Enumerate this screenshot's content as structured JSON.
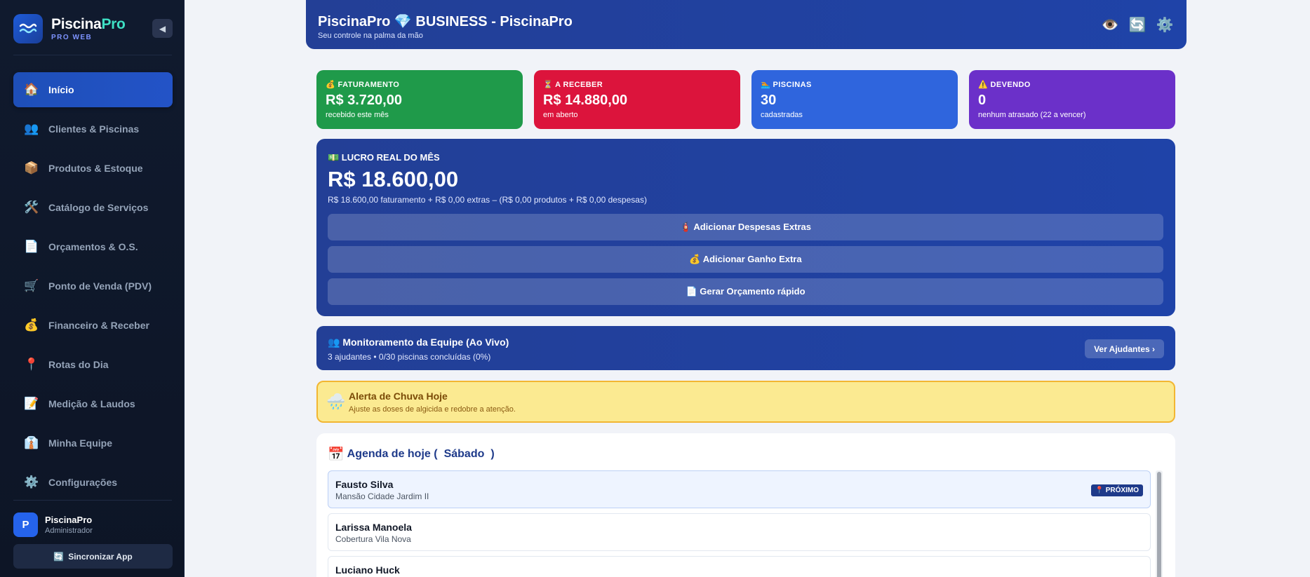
{
  "sidebar": {
    "brand": {
      "name_main": "Piscina",
      "name_accent": "Pro",
      "subtitle": "PRO WEB"
    },
    "collapse_icon": "◀",
    "items": [
      {
        "icon": "🏠",
        "icon_name": "home-icon",
        "label": "Início",
        "active": true
      },
      {
        "icon": "👥",
        "icon_name": "users-icon",
        "label": "Clientes & Piscinas"
      },
      {
        "icon": "📦",
        "icon_name": "package-icon",
        "label": "Produtos & Estoque"
      },
      {
        "icon": "🛠️",
        "icon_name": "tools-icon",
        "label": "Catálogo de Serviços"
      },
      {
        "icon": "📄",
        "icon_name": "document-icon",
        "label": "Orçamentos & O.S."
      },
      {
        "icon": "🛒",
        "icon_name": "cart-icon",
        "label": "Ponto de Venda (PDV)"
      },
      {
        "icon": "💰",
        "icon_name": "money-bag-icon",
        "label": "Financeiro & Receber"
      },
      {
        "icon": "📍",
        "icon_name": "pin-icon",
        "label": "Rotas do Dia"
      },
      {
        "icon": "📝",
        "icon_name": "memo-icon",
        "label": "Medição & Laudos"
      },
      {
        "icon": "👔",
        "icon_name": "team-icon",
        "label": "Minha Equipe"
      },
      {
        "icon": "⚙️",
        "icon_name": "gear-icon",
        "label": "Configurações"
      }
    ],
    "user": {
      "initial": "P",
      "name": "PiscinaPro",
      "role": "Administrador"
    },
    "sync": {
      "icon": "🔄",
      "label": "Sincronizar App"
    }
  },
  "header": {
    "title": "PiscinaPro 💎 BUSINESS - PiscinaPro",
    "subtitle": "Seu controle na palma da mão",
    "icons": [
      {
        "glyph": "👁️",
        "name": "eye-icon"
      },
      {
        "glyph": "🔄",
        "name": "refresh-icon"
      },
      {
        "glyph": "⚙️",
        "name": "settings-icon"
      }
    ]
  },
  "kpis": [
    {
      "label": "💰 FATURAMENTO",
      "value": "R$ 3.720,00",
      "sub": "recebido este mês",
      "color": "#1f9a4a"
    },
    {
      "label": "⏳ A RECEBER",
      "value": "R$ 14.880,00",
      "sub": "em aberto",
      "color": "#dc143c"
    },
    {
      "label": "🏊 PISCINAS",
      "value": "30",
      "sub": "cadastradas",
      "color": "#2f65dd"
    },
    {
      "label": "⚠️ DEVENDO",
      "value": "0",
      "sub": "nenhum atrasado (22 a vencer)",
      "color": "#6b30c9"
    }
  ],
  "lucro": {
    "label": "💵 LUCRO REAL DO MÊS",
    "value": "R$ 18.600,00",
    "detail": "R$ 18.600,00 faturamento + R$ 0,00 extras – (R$ 0,00 produtos + R$ 0,00 despesas)",
    "buttons": [
      "🧯 Adicionar Despesas Extras",
      "💰 Adicionar Ganho Extra",
      "📄 Gerar Orçamento rápido"
    ]
  },
  "monitor": {
    "title": "👥 Monitoramento da Equipe (Ao Vivo)",
    "sub": "3 ajudantes • 0/30 piscinas concluídas (0%)",
    "button": "Ver Ajudantes ›"
  },
  "alert": {
    "icon": "🌧️",
    "title": "Alerta de Chuva Hoje",
    "sub": "Ajuste as doses de algicida e redobre a atenção."
  },
  "agenda": {
    "icon": "📅",
    "title_prefix": "Agenda de hoje (",
    "day": "Sábado",
    "title_suffix": ")",
    "items": [
      {
        "name": "Fausto Silva",
        "place": "Mansão Cidade Jardim II",
        "badge": "📍 PRÓXIMO"
      },
      {
        "name": "Larissa Manoela",
        "place": "Cobertura Vila Nova",
        "badge": ""
      },
      {
        "name": "Luciano Huck",
        "place": "",
        "badge": ""
      }
    ]
  }
}
